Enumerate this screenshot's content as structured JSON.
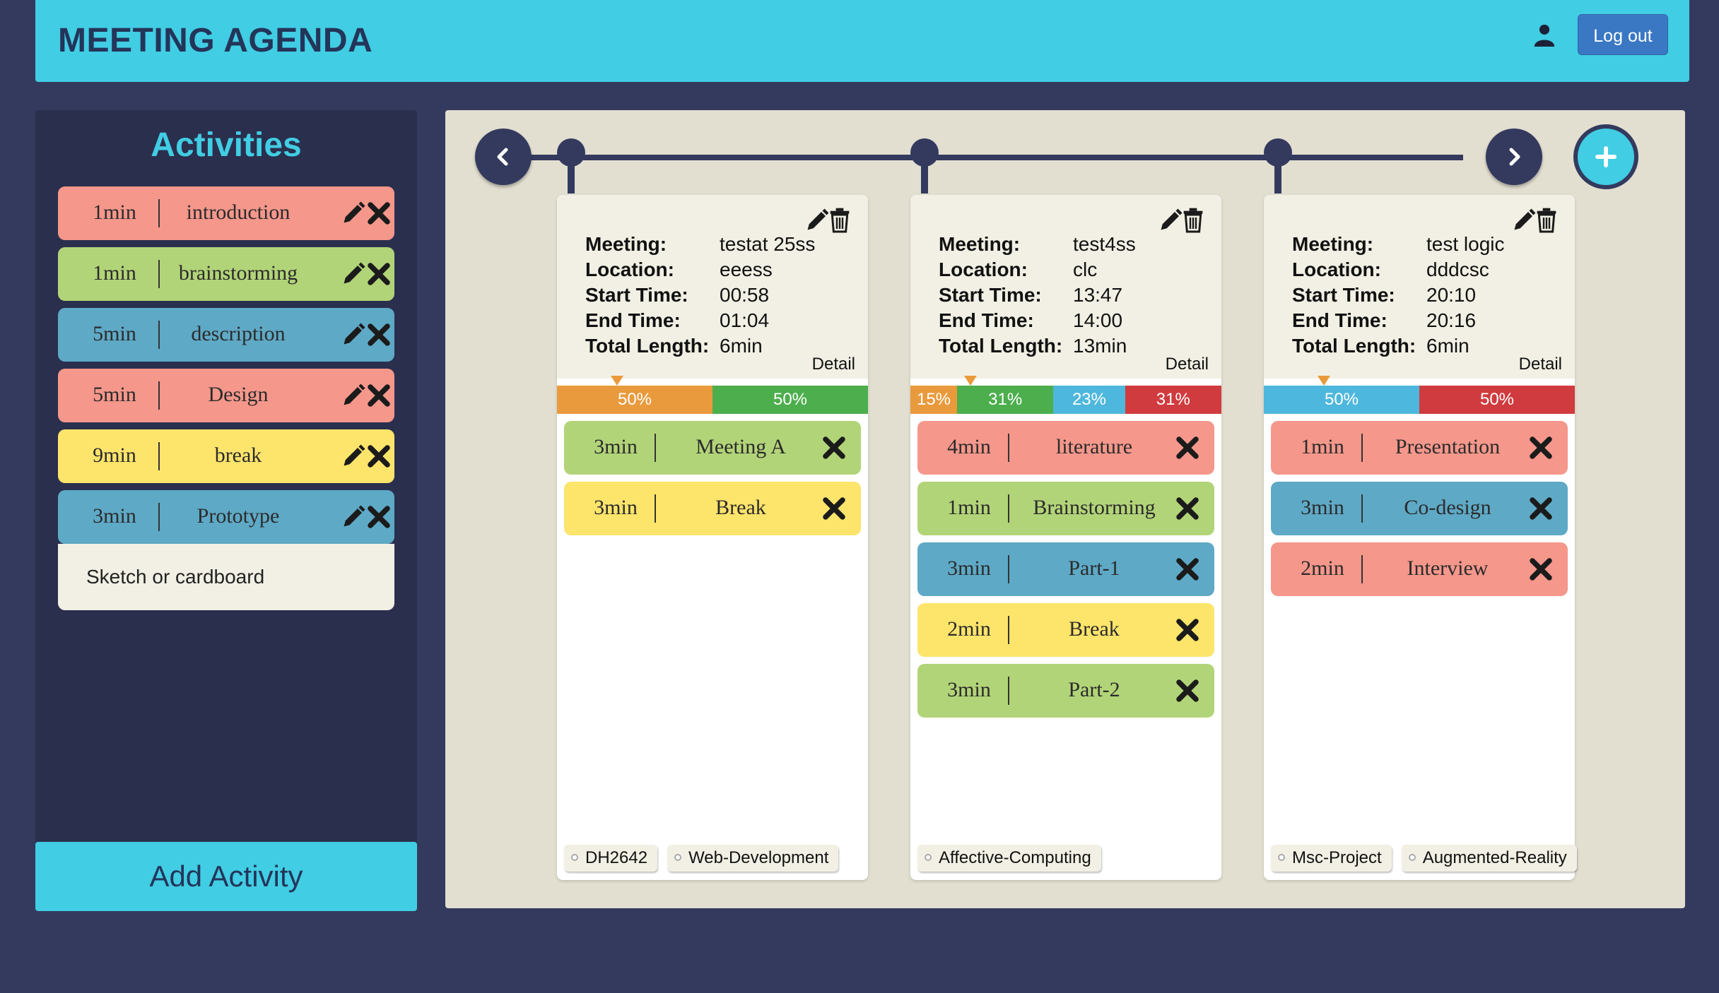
{
  "header": {
    "title": "MEETING AGENDA",
    "user_icon": "user-icon",
    "logout_label": "Log out"
  },
  "colors": {
    "header_bg": "#41cde3",
    "page_bg": "#343a5e",
    "sidebar_bg": "#2a2f4e",
    "salmon": "#f5978b",
    "green": "#b2d478",
    "blue": "#5ea9c6",
    "yellow": "#fde46b",
    "bar_orange": "#e99a3c",
    "bar_green": "#4cae4c",
    "bar_blue": "#4eb7dd",
    "bar_red": "#d03b3f"
  },
  "sidebar": {
    "title": "Activities",
    "items": [
      {
        "duration": "1min",
        "name": "introduction",
        "color": "#f5978b"
      },
      {
        "duration": "1min",
        "name": "brainstorming",
        "color": "#b2d478"
      },
      {
        "duration": "5min",
        "name": "description",
        "color": "#5ea9c6"
      },
      {
        "duration": "5min",
        "name": "Design",
        "color": "#f5978b"
      },
      {
        "duration": "9min",
        "name": "break",
        "color": "#fde46b"
      },
      {
        "duration": "3min",
        "name": "Prototype",
        "color": "#5ea9c6",
        "description": "Sketch or cardboard"
      }
    ],
    "add_label": "Add Activity"
  },
  "labels": {
    "meeting": "Meeting:",
    "location": "Location:",
    "start_time": "Start Time:",
    "end_time": "End Time:",
    "total_length": "Total Length:",
    "detail": "Detail"
  },
  "meetings": [
    {
      "meeting": "testat 25ss",
      "location": "eeess",
      "start": "00:58",
      "end": "01:04",
      "total": "6min",
      "breakdown": [
        {
          "label": "50%",
          "value": 50,
          "color": "#e99a3c"
        },
        {
          "label": "50%",
          "value": 50,
          "color": "#4cae4c"
        }
      ],
      "items": [
        {
          "duration": "3min",
          "name": "Meeting A",
          "color": "#b2d478"
        },
        {
          "duration": "3min",
          "name": "Break",
          "color": "#fde46b"
        }
      ],
      "tags": [
        "DH2642",
        "Web-Development"
      ]
    },
    {
      "meeting": "test4ss",
      "location": "clc",
      "start": "13:47",
      "end": "14:00",
      "total": "13min",
      "breakdown": [
        {
          "label": "15%",
          "value": 15,
          "color": "#e99a3c"
        },
        {
          "label": "31%",
          "value": 31,
          "color": "#4cae4c"
        },
        {
          "label": "23%",
          "value": 23,
          "color": "#4eb7dd"
        },
        {
          "label": "31%",
          "value": 31,
          "color": "#d03b3f"
        }
      ],
      "items": [
        {
          "duration": "4min",
          "name": "literature",
          "color": "#f5978b"
        },
        {
          "duration": "1min",
          "name": "Brainstorming",
          "color": "#b2d478"
        },
        {
          "duration": "3min",
          "name": "Part-1",
          "color": "#5ea9c6"
        },
        {
          "duration": "2min",
          "name": "Break",
          "color": "#fde46b"
        },
        {
          "duration": "3min",
          "name": "Part-2",
          "color": "#b2d478"
        }
      ],
      "tags": [
        "Affective-Computing"
      ]
    },
    {
      "meeting": "test logic",
      "location": "dddcsc",
      "start": "20:10",
      "end": "20:16",
      "total": "6min",
      "breakdown": [
        {
          "label": "50%",
          "value": 50,
          "color": "#4eb7dd"
        },
        {
          "label": "50%",
          "value": 50,
          "color": "#d03b3f"
        }
      ],
      "items": [
        {
          "duration": "1min",
          "name": "Presentation",
          "color": "#f5978b"
        },
        {
          "duration": "3min",
          "name": "Co-design",
          "color": "#5ea9c6"
        },
        {
          "duration": "2min",
          "name": "Interview",
          "color": "#f5978b"
        }
      ],
      "tags": [
        "Msc-Project",
        "Augmented-Reality"
      ]
    }
  ],
  "timeline": {
    "prev_icon": "chevron-left-icon",
    "next_icon": "chevron-right-icon",
    "add_icon": "plus-icon"
  }
}
